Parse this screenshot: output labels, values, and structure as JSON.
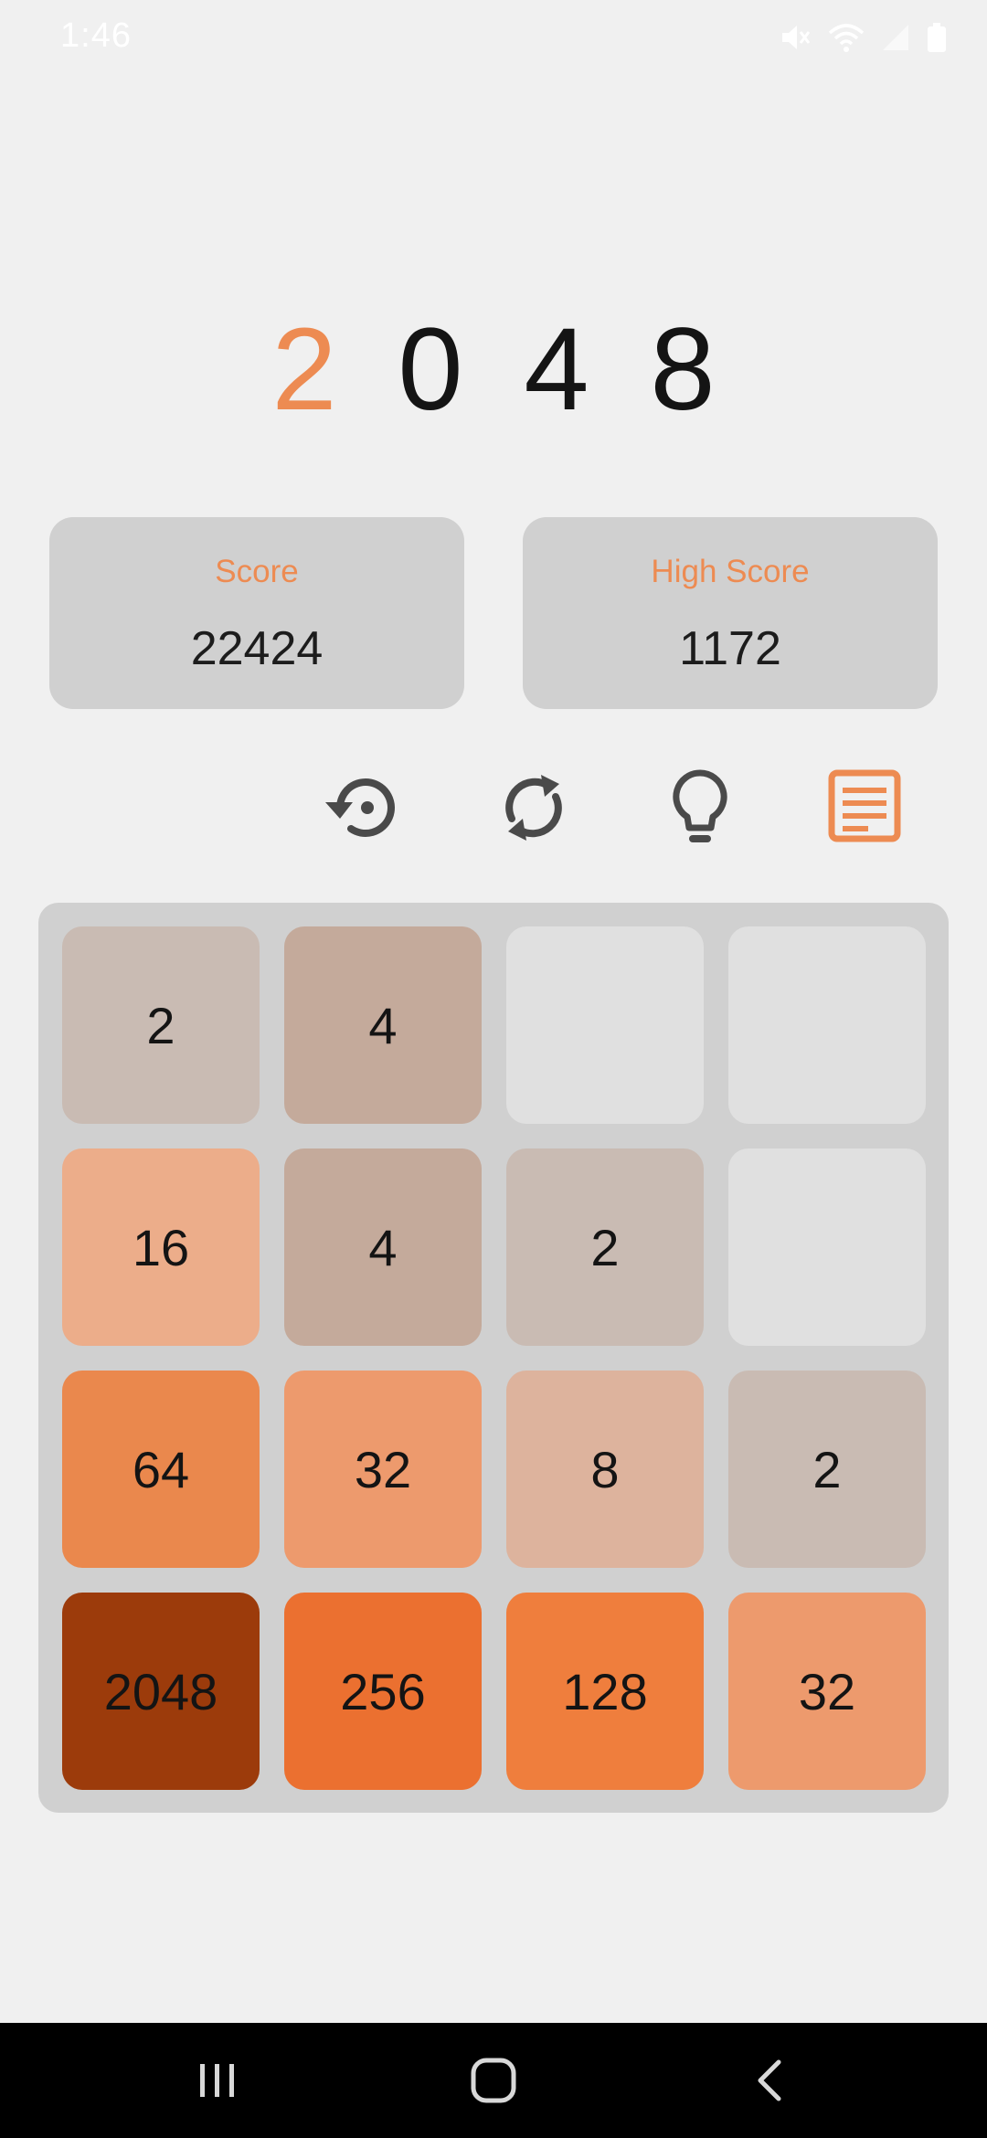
{
  "status_bar": {
    "time": "1:46",
    "icons": [
      "mute-icon",
      "wifi-icon",
      "signal-icon",
      "battery-icon"
    ]
  },
  "title": {
    "letters": [
      "2",
      "0",
      "4",
      "8"
    ],
    "accent_color": "#ed8b52"
  },
  "score": {
    "label": "Score",
    "value": "22424"
  },
  "high_score": {
    "label": "High Score",
    "value": "1172"
  },
  "toolbar": {
    "buttons": [
      {
        "name": "undo-button",
        "icon": "undo-icon"
      },
      {
        "name": "restart-button",
        "icon": "restart-icon"
      },
      {
        "name": "hint-button",
        "icon": "lightbulb-icon"
      },
      {
        "name": "log-button",
        "icon": "notes-icon",
        "color": "#ed8b52"
      }
    ]
  },
  "board": {
    "size": 4,
    "tiles": [
      [
        "2",
        "4",
        "",
        ""
      ],
      [
        "16",
        "4",
        "2",
        ""
      ],
      [
        "64",
        "32",
        "8",
        "2"
      ],
      [
        "2048",
        "256",
        "128",
        "32"
      ]
    ],
    "colors": {
      "": "#e0e0e0",
      "2": "#c9bbb3",
      "4": "#c4aa9b",
      "8": "#ddb39d",
      "16": "#ecad8a",
      "32": "#ed9a6d",
      "64": "#ea884d",
      "128": "#ef7e3d",
      "256": "#eb7030",
      "2048": "#9c3b0b"
    }
  },
  "nav_bar": {
    "buttons": [
      "recents-icon",
      "home-icon",
      "back-icon"
    ]
  }
}
